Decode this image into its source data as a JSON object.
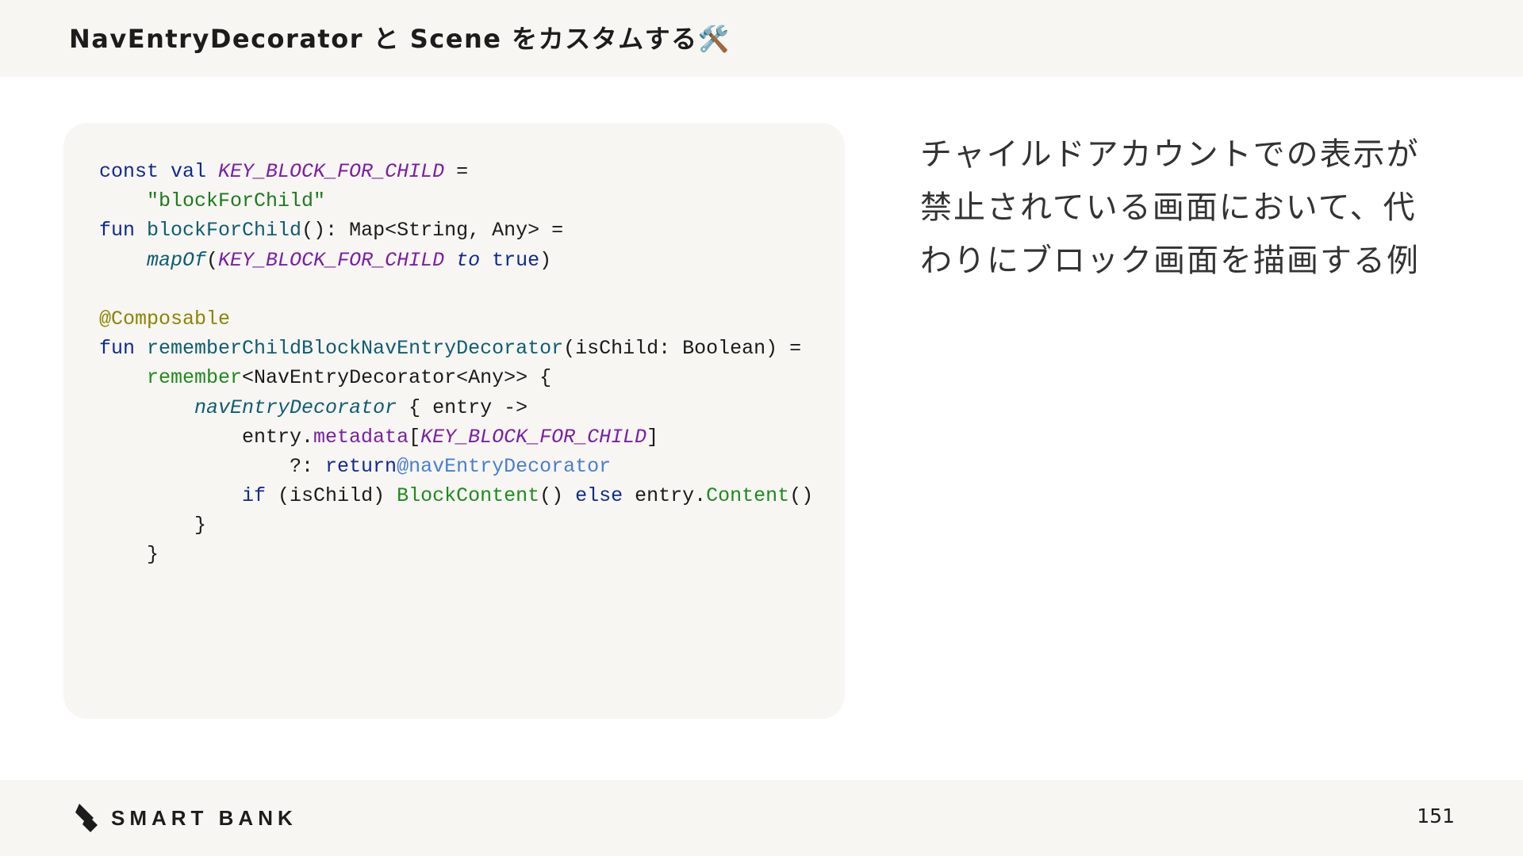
{
  "header": {
    "title": "NavEntryDecorator と Scene をカスタムする🛠️"
  },
  "code": {
    "lines": [
      [
        {
          "t": "const val ",
          "c": "kw"
        },
        {
          "t": "KEY_BLOCK_FOR_CHILD",
          "c": "const"
        },
        {
          "t": " =",
          "c": "plain"
        }
      ],
      [
        {
          "t": "    ",
          "c": "plain"
        },
        {
          "t": "\"blockForChild\"",
          "c": "str"
        }
      ],
      [
        {
          "t": "fun ",
          "c": "kw"
        },
        {
          "t": "blockForChild",
          "c": "fn"
        },
        {
          "t": "(): Map<String, Any> =",
          "c": "plain"
        }
      ],
      [
        {
          "t": "    ",
          "c": "plain"
        },
        {
          "t": "mapOf",
          "c": "italfn"
        },
        {
          "t": "(",
          "c": "plain"
        },
        {
          "t": "KEY_BLOCK_FOR_CHILD",
          "c": "const"
        },
        {
          "t": " to ",
          "c": "kwital"
        },
        {
          "t": "true",
          "c": "kw"
        },
        {
          "t": ")",
          "c": "plain"
        }
      ],
      [
        {
          "t": "",
          "c": "plain"
        }
      ],
      [
        {
          "t": "@Composable",
          "c": "annot"
        }
      ],
      [
        {
          "t": "fun ",
          "c": "kw"
        },
        {
          "t": "rememberChildBlockNavEntryDecorator",
          "c": "fn"
        },
        {
          "t": "(isChild: Boolean) =",
          "c": "plain"
        }
      ],
      [
        {
          "t": "    ",
          "c": "plain"
        },
        {
          "t": "remember",
          "c": "green"
        },
        {
          "t": "<NavEntryDecorator<Any>> {",
          "c": "plain"
        }
      ],
      [
        {
          "t": "        ",
          "c": "plain"
        },
        {
          "t": "navEntryDecorator",
          "c": "italfn"
        },
        {
          "t": " { entry ->",
          "c": "plain"
        }
      ],
      [
        {
          "t": "            entry.",
          "c": "plain"
        },
        {
          "t": "metadata",
          "c": "prop"
        },
        {
          "t": "[",
          "c": "plain"
        },
        {
          "t": "KEY_BLOCK_FOR_CHILD",
          "c": "const"
        },
        {
          "t": "]",
          "c": "plain"
        }
      ],
      [
        {
          "t": "                ?: ",
          "c": "plain"
        },
        {
          "t": "return",
          "c": "kw"
        },
        {
          "t": "@navEntryDecorator",
          "c": "label"
        }
      ],
      [
        {
          "t": "            ",
          "c": "plain"
        },
        {
          "t": "if",
          "c": "kw"
        },
        {
          "t": " (isChild) ",
          "c": "plain"
        },
        {
          "t": "BlockContent",
          "c": "green"
        },
        {
          "t": "() ",
          "c": "plain"
        },
        {
          "t": "else",
          "c": "kw"
        },
        {
          "t": " entry.",
          "c": "plain"
        },
        {
          "t": "Content",
          "c": "green"
        },
        {
          "t": "()",
          "c": "plain"
        }
      ],
      [
        {
          "t": "        }",
          "c": "plain"
        }
      ],
      [
        {
          "t": "    }",
          "c": "plain"
        }
      ]
    ]
  },
  "description": {
    "lines": [
      "チャイルドアカウントでの表示が",
      "禁止されている画面において、代",
      "わりにブロック画面を描画する例"
    ]
  },
  "footer": {
    "logo_text": "SMART BANK",
    "page_number": "151"
  },
  "colors": {
    "background": "#ffffff",
    "panel": "#f7f6f2",
    "keyword": "#0f2b8f",
    "constant": "#7b1fa2",
    "string": "#1e7a1e",
    "annotation": "#8c8500",
    "label": "#4a7ecf"
  },
  "icons": {
    "title_icon": "hammer-and-wrench-icon",
    "logo_icon": "smartbank-logo-mark-icon"
  }
}
